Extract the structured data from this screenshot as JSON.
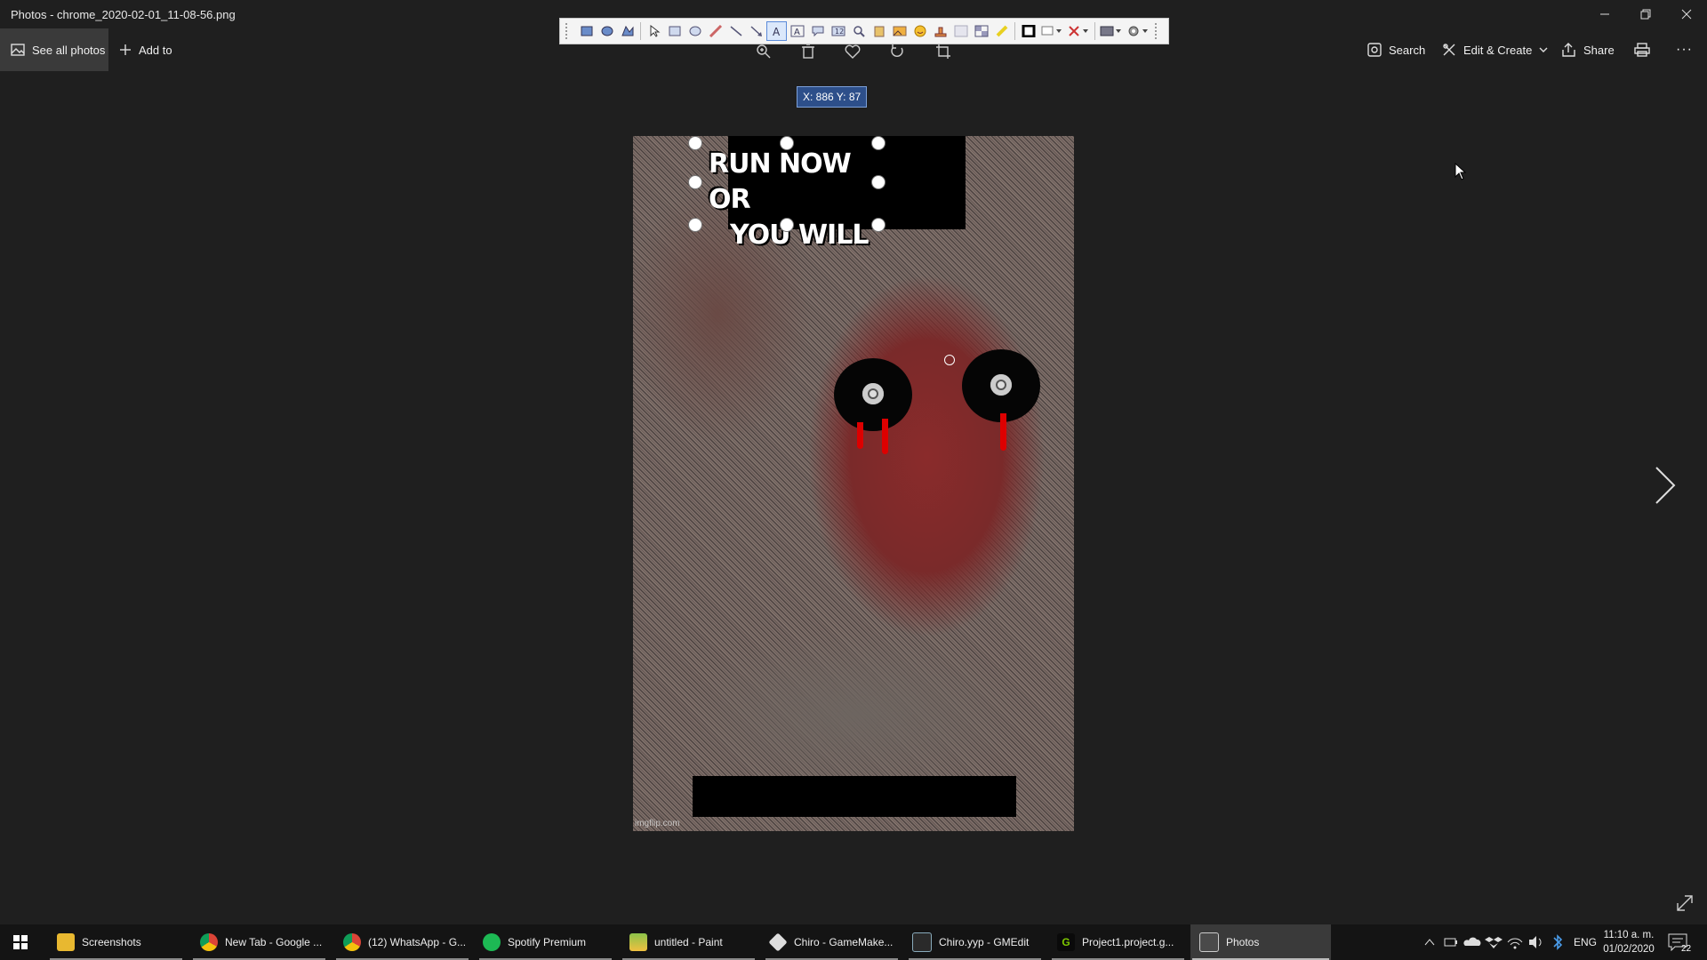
{
  "window": {
    "title": "Photos - chrome_2020-02-01_11-08-56.png"
  },
  "commandbar": {
    "see_all_photos": "See all photos",
    "add_to": "Add to",
    "search": "Search",
    "edit_create": "Edit & Create",
    "share": "Share",
    "more": "···"
  },
  "annotation_toolbar": {
    "selected_tool": "text-tool",
    "tools": [
      "rectangle-fill",
      "ellipse-fill",
      "freeform-fill",
      "pointer",
      "rectangle",
      "ellipse",
      "pencil",
      "line",
      "arrow",
      "text",
      "text-outline",
      "callout",
      "counter",
      "magnifier",
      "paste",
      "image",
      "emoji",
      "stamp",
      "blur",
      "pixelate",
      "highlighter",
      "color",
      "shadow",
      "clear",
      "board",
      "settings"
    ]
  },
  "coordinate_tooltip": "X: 886 Y: 87",
  "image": {
    "meme_text_line1": "RUN NOW OR",
    "meme_text_line2": "YOU WILL",
    "watermark": "imgflip.com"
  },
  "taskbar": {
    "items": [
      {
        "label": "Screenshots",
        "icon": "folder-icon"
      },
      {
        "label": "New Tab - Google ...",
        "icon": "chrome-icon"
      },
      {
        "label": "(12) WhatsApp - G...",
        "icon": "chrome-icon"
      },
      {
        "label": "Spotify Premium",
        "icon": "spotify-icon"
      },
      {
        "label": "untitled - Paint",
        "icon": "paint-icon"
      },
      {
        "label": "Chiro - GameMake...",
        "icon": "gamemaker-icon"
      },
      {
        "label": "Chiro.yyp - GMEdit",
        "icon": "gmedit-icon"
      },
      {
        "label": "Project1.project.g...",
        "icon": "gamemaker-icon"
      },
      {
        "label": "Photos",
        "icon": "photos-icon"
      }
    ],
    "tray": {
      "language": "ENG",
      "time": "11:10 a. m.",
      "date": "01/02/2020",
      "notification_count": "22"
    }
  },
  "colors": {
    "app_background": "#1f1f1f",
    "taskbar_background": "#141414",
    "tooltip_background": "#2d4f8a",
    "blood_red": "#dd0000"
  }
}
